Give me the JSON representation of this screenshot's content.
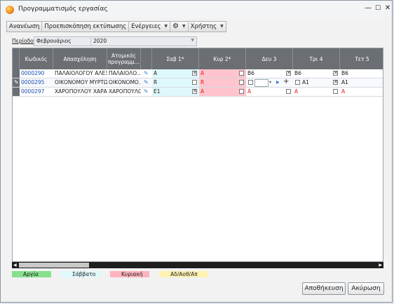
{
  "window": {
    "title": "Προγραμματισμός εργασίας",
    "minimize": "—",
    "maximize": "☐",
    "close": "✕"
  },
  "toolbar": [
    {
      "label": "Ανανέωση",
      "menu": false
    },
    {
      "label": "Προεπισκόπηση εκτύπωσης",
      "menu": false
    },
    {
      "label": "Ενέργειες",
      "menu": true
    },
    {
      "label": "⚙",
      "menu": true
    },
    {
      "label": "Χρήστης",
      "menu": true
    }
  ],
  "period": {
    "label": "Περίοδος",
    "month": "Φεβρουάριος",
    "year": "2020"
  },
  "grid": {
    "columns": [
      "Κωδικός",
      "Απασχόληση",
      "Ατομικός προγραμμ...",
      "",
      "Σαβ 1*",
      "Κυρ 2*",
      "Δευ 3",
      "Τρι 4",
      "Τετ 5"
    ],
    "rows": [
      {
        "code": "0000290",
        "employment": "ΠΑΛΑΙΟΛΟΓΟΥ ΑΛΕΞ...",
        "program": "ΠΑΛΑΙΟΛΟ...",
        "sat": "A",
        "sat_checked": true,
        "sun": "A",
        "mon": "B6",
        "mon_checked": true,
        "tue": "B6",
        "tue_checked": true,
        "wed": "B6"
      },
      {
        "code": "0000295",
        "employment": "ΟΙΚΟΝΟΜΟΥ ΜΥΡΤΩ ...",
        "program": "ΟΙΚΟΝΟΜΟ...",
        "sat": "R",
        "sat_checked": false,
        "sun": "R",
        "mon": "",
        "mon_checked": false,
        "tue": "A1",
        "tue_checked": true,
        "wed": "A1"
      },
      {
        "code": "0000297",
        "employment": "ΧΑΡΟΠΟΥΛΟΥ ΧΑΡΑ Α...",
        "program": "ΧΑΡΟΠΟΥΛΟ...",
        "sat": "E1",
        "sat_checked": true,
        "sun": "A",
        "mon": "A",
        "mon_checked": false,
        "tue": "A",
        "tue_checked": false,
        "wed": "A"
      }
    ]
  },
  "legend": [
    {
      "label": "Αργία",
      "color": "#86e08c"
    },
    {
      "label": "Σάββατο",
      "color": "#dff8fb"
    },
    {
      "label": "Κυριακή",
      "color": "#ffb3bf"
    },
    {
      "label": "Αδ/Αοθ/Απ",
      "color": "#fff2b3"
    }
  ],
  "buttons": {
    "save": "Αποθήκευση",
    "cancel": "Ακύρωση"
  }
}
